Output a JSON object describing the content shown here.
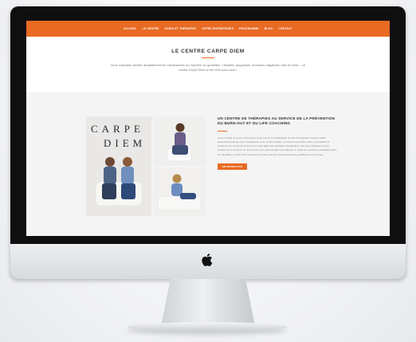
{
  "nav": {
    "items": [
      "ACCUEIL",
      "LE CENTRE",
      "SOINS ET THÉRAPIES",
      "OFFRE ENTREPRISES",
      "PROGRAMME",
      "BLOG",
      "CONTACT"
    ]
  },
  "hero": {
    "title": "LE CENTRE CARPE DIEM",
    "text": "Vous souhaitez arrêter durablement les mécanismes du mal-être au quotidien ? Anxiété, angoisses, émotions négatives, mal de vivre... Le centre Carpe Diem a été créé pour vous !"
  },
  "collage": {
    "brand_word_1": "CARPE",
    "brand_word_2": "DIEM"
  },
  "section": {
    "heading": "UN CENTRE DE THÉRAPIES AU SERVICE DE LA PRÉVENTION DU BURN-OUT ET DU LIFE COACHING",
    "body": "Créé en 2015, le centre Carpe Diem est le fruit de la collaboration de deux thérapeutes agréées ARSA passionnées par les soins énergétiques et le soutien durable. Le Centre Carpe Diem offre la possibilité de s’épanouir au niveau du corps et de l’esprit grâce aux thérapies énergétiques, aux soins physiques et aux produits de la boutique. Ici, tout est mis pour accompagner les individus en quête de solutions et d’équilibre dans leur quotidien et offrent des moments conviviaux par des questionnements spécifiques ou ponctuels.",
    "button": "EN SAVOIR PLUS"
  },
  "colors": {
    "accent": "#e86a23",
    "band": "#f4f4f4",
    "bezel": "#0f0f10"
  },
  "icons": {
    "logo": "apple-logo-icon"
  }
}
